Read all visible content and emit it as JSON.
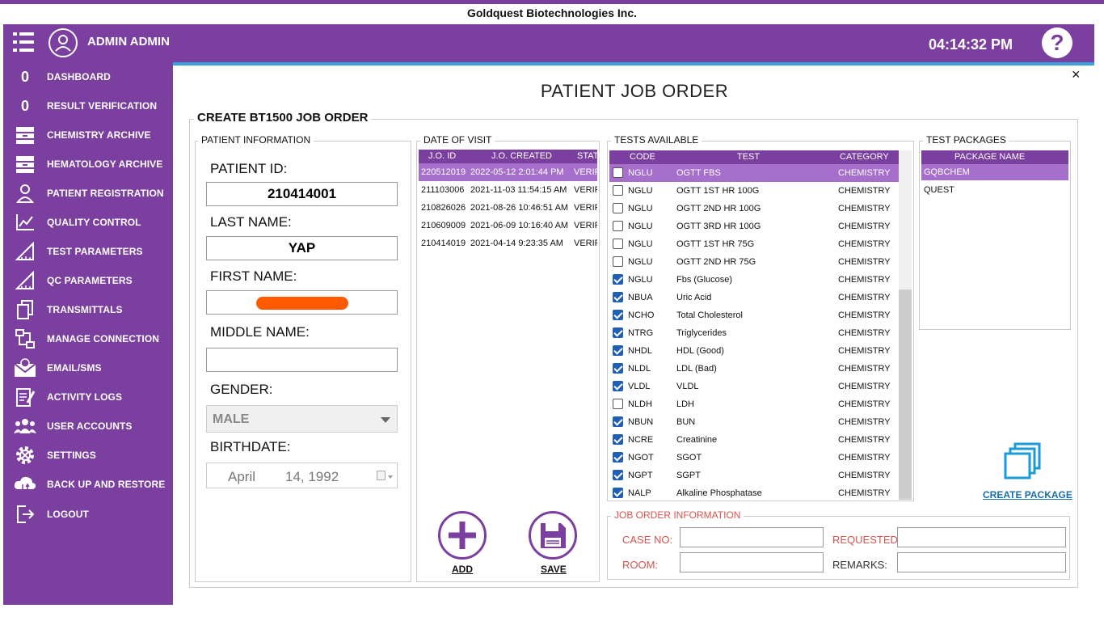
{
  "app_title": "Goldquest Biotechnologies Inc.",
  "header": {
    "username": "ADMIN  ADMIN",
    "clock": "04:14:32 PM",
    "help": "?"
  },
  "sidebar": {
    "items": [
      {
        "label": "DASHBOARD",
        "badge": "0",
        "icon": "count-badge"
      },
      {
        "label": "RESULT VERIFICATION",
        "badge": "0",
        "icon": "count-badge"
      },
      {
        "label": "CHEMISTRY ARCHIVE",
        "icon": "archive-icon"
      },
      {
        "label": "HEMATOLOGY ARCHIVE",
        "icon": "archive-icon"
      },
      {
        "label": "PATIENT REGISTRATION",
        "icon": "patient-icon"
      },
      {
        "label": "QUALITY CONTROL",
        "icon": "chart-icon"
      },
      {
        "label": "TEST PARAMETERS",
        "icon": "ruler-icon"
      },
      {
        "label": "QC PARAMETERS",
        "icon": "ruler-icon"
      },
      {
        "label": "TRANSMITTALS",
        "icon": "documents-icon"
      },
      {
        "label": "MANAGE CONNECTION",
        "icon": "network-icon"
      },
      {
        "label": "EMAIL/SMS",
        "icon": "mail-icon"
      },
      {
        "label": "ACTIVITY LOGS",
        "icon": "log-icon"
      },
      {
        "label": "USER ACCOUNTS",
        "icon": "users-icon"
      },
      {
        "label": "SETTINGS",
        "icon": "gear-icon"
      },
      {
        "label": "BACK UP AND RESTORE",
        "icon": "cloud-icon"
      },
      {
        "label": "LOGOUT",
        "icon": "logout-icon"
      }
    ]
  },
  "page": {
    "title": "PATIENT JOB ORDER",
    "form_title": "CREATE BT1500 JOB ORDER",
    "close": "×"
  },
  "patient": {
    "group_title": "PATIENT INFORMATION",
    "id_label": "PATIENT ID:",
    "id_value": "210414001",
    "last_label": "LAST NAME:",
    "last_value": "YAP",
    "first_label": "FIRST NAME:",
    "middle_label": "MIDDLE NAME:",
    "middle_value": "",
    "gender_label": "GENDER:",
    "gender_value": "MALE",
    "birth_label": "BIRTHDATE:",
    "birth_month": "April",
    "birth_day": "14, 1992"
  },
  "visits": {
    "group_title": "DATE OF VISIT",
    "columns": [
      "J.O. ID",
      "J.O. CREATED",
      "STATU"
    ],
    "rows": [
      {
        "id": "220512019",
        "created": "2022-05-12 2:01:44 PM",
        "status": "VERIF"
      },
      {
        "id": "211103006",
        "created": "2021-11-03 11:54:15 AM",
        "status": "VERIF"
      },
      {
        "id": "210826026",
        "created": "2021-08-26 10:46:51 AM",
        "status": "VERIF"
      },
      {
        "id": "210609009",
        "created": "2021-06-09 10:16:40 AM",
        "status": "VERIF"
      },
      {
        "id": "210414019",
        "created": "2021-04-14 9:23:35 AM",
        "status": "VERIF"
      }
    ]
  },
  "tests": {
    "group_title": "TESTS AVAILABLE",
    "columns": [
      "CODE",
      "TEST",
      "CATEGORY"
    ],
    "rows": [
      {
        "code": "NGLU",
        "test": "OGTT  FBS",
        "category": "CHEMISTRY",
        "checked": false
      },
      {
        "code": "NGLU",
        "test": "OGTT 1ST HR 100G",
        "category": "CHEMISTRY",
        "checked": false
      },
      {
        "code": "NGLU",
        "test": "OGTT 2ND HR 100G",
        "category": "CHEMISTRY",
        "checked": false
      },
      {
        "code": "NGLU",
        "test": "OGTT 3RD HR 100G",
        "category": "CHEMISTRY",
        "checked": false
      },
      {
        "code": "NGLU",
        "test": "OGTT 1ST HR 75G",
        "category": "CHEMISTRY",
        "checked": false
      },
      {
        "code": "NGLU",
        "test": "OGTT 2ND HR 75G",
        "category": "CHEMISTRY",
        "checked": false
      },
      {
        "code": "NGLU",
        "test": "Fbs (Glucose)",
        "category": "CHEMISTRY",
        "checked": true
      },
      {
        "code": "NBUA",
        "test": "Uric Acid",
        "category": "CHEMISTRY",
        "checked": true
      },
      {
        "code": "NCHO",
        "test": "Total Cholesterol",
        "category": "CHEMISTRY",
        "checked": true
      },
      {
        "code": "NTRG",
        "test": "Triglycerides",
        "category": "CHEMISTRY",
        "checked": true
      },
      {
        "code": "NHDL",
        "test": "HDL (Good)",
        "category": "CHEMISTRY",
        "checked": true
      },
      {
        "code": "NLDL",
        "test": "LDL (Bad)",
        "category": "CHEMISTRY",
        "checked": true
      },
      {
        "code": "VLDL",
        "test": "VLDL",
        "category": "CHEMISTRY",
        "checked": true
      },
      {
        "code": "NLDH",
        "test": "LDH",
        "category": "CHEMISTRY",
        "checked": false
      },
      {
        "code": "NBUN",
        "test": "BUN",
        "category": "CHEMISTRY",
        "checked": true
      },
      {
        "code": "NCRE",
        "test": "Creatinine",
        "category": "CHEMISTRY",
        "checked": true
      },
      {
        "code": "NGOT",
        "test": "SGOT",
        "category": "CHEMISTRY",
        "checked": true
      },
      {
        "code": "NGPT",
        "test": "SGPT",
        "category": "CHEMISTRY",
        "checked": true
      },
      {
        "code": "NALP",
        "test": "Alkaline Phosphatase",
        "category": "CHEMISTRY",
        "checked": true
      }
    ]
  },
  "packages": {
    "group_title": "TEST PACKAGES",
    "column": "PACKAGE NAME",
    "rows": [
      "GQBCHEM",
      "QUEST"
    ],
    "create_label": "CREATE PACKAGE"
  },
  "actions": {
    "add_label": "ADD",
    "save_label": "SAVE"
  },
  "job_order": {
    "group_title": "JOB ORDER INFORMATION",
    "case_label": "CASE NO:",
    "room_label": "ROOM:",
    "requested_label": "REQUESTED:",
    "remarks_label": "REMARKS:"
  },
  "colors": {
    "brand": "#7b3fa0",
    "selected_row": "#a66fcc",
    "accent_line": "#3aa0d8",
    "link": "#1a6da8",
    "redaction": "#ff5a00"
  }
}
